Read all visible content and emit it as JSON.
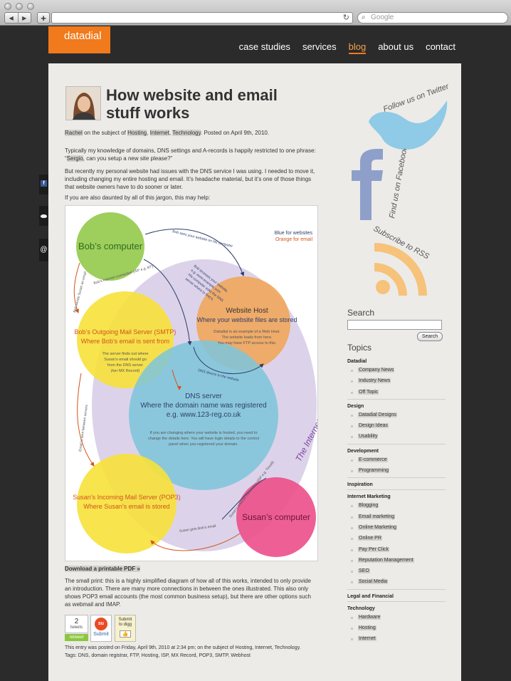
{
  "browser": {
    "search_placeholder": "Google",
    "reload_glyph": "↻",
    "back_glyph": "◀",
    "forward_glyph": "▶",
    "new_tab_glyph": "+"
  },
  "site": {
    "logo": "datadial",
    "nav": [
      {
        "label": "case studies",
        "active": false
      },
      {
        "label": "services",
        "active": false
      },
      {
        "label": "blog",
        "active": true
      },
      {
        "label": "about us",
        "active": false
      },
      {
        "label": "contact",
        "active": false
      }
    ]
  },
  "post": {
    "title": "How website and email stuff works",
    "byline": {
      "author": "Rachel",
      "on_subject": "on the subject of",
      "tags": [
        "Hosting",
        "Internet",
        "Technology"
      ],
      "posted": ". Posted on April 9th, 2010."
    },
    "p1a": "Typically my knowledge of domains, DNS settings and A-records is happily restricted to one phrase: “",
    "p1b": "Sergio",
    "p1c": ", can you setup a new site please?”",
    "p2": "But recently my personal website had issues with the DNS service I was using. I needed to move it, including changing my entire hosting and email. It’s headache material, but it’s one of those things that website owners have to do sooner or later.",
    "p3": "If you are also daunted by all of this jargon, this may help:",
    "download": "Download a printable PDF »",
    "p4": "The small print: this is a highly simplified diagram of how all of this works, intended to only provide an introduction. There are many more connections in between the ones illustrated. This also only shows POP3 email accounts (the most common business setup), but there are other options such as webmail and IMAP.",
    "share": {
      "tweet_count": "2",
      "tweets_label": "tweets",
      "retweet": "retweet",
      "submit": "Submit",
      "digg_a": "Submit",
      "digg_b": "to digg",
      "digg_thumb": "👍"
    },
    "footer1": "This entry was posted on Friday, April 9th, 2010 at 2:34 pm; on the subject of Hosting, Internet, Technology.",
    "footer2_label": "Tags:",
    "footer2_tags": "DNS, domain registrar, FTP, Hosting, ISP, MX Record, POP3, SMTP, Webhost"
  },
  "diagram": {
    "legend_blue": "Blue for websites",
    "legend_orange": "Orange for email",
    "bobs_computer": "Bob’s computer",
    "web_host_title": "Website Host",
    "web_host_sub": "Where your website files are stored",
    "web_host_note1": "Datadial is an example of a Web Host.",
    "web_host_note2": "The website loads from here.",
    "web_host_note3": "You may have FTP access to this.",
    "smtp_title": "Bob’s Outgoing Mail Server (SMTP)",
    "smtp_sub": "Where Bob’s email is sent from",
    "smtp_note1": "The server finds out where",
    "smtp_note2": "Susan’s email should go",
    "smtp_note3": "from the DNS server",
    "smtp_note4": "(her MX Record)",
    "dns_title": "DNS server",
    "dns_sub": "Where the domain name was registered",
    "dns_eg": "e.g. www.123-reg.co.uk",
    "dns_note1": "If you are changing where your website is hosted, you need to",
    "dns_note2": "change the details here. You will have login details to the control",
    "dns_note3": "panel when you registered your domain.",
    "pop3_title": "Susan’s Incoming Mail Server (POP3)",
    "pop3_sub": "Where Susan’s email is stored",
    "susans_computer": "Susan’s computer",
    "internet": "The Internet",
    "arrow_sees": "Bob sees your website on his computer",
    "arrow_conn": "Bob’s Internet connection (ISP e.g. BT)",
    "arrow_browses": "Bob browses your website,",
    "arrow_browses2": "e.g. www.example.com",
    "arrow_browses3": "His computer asks the DNS",
    "arrow_browses4": "server where to find it.",
    "arrow_dns_directs": "DNS directs to the website",
    "arrow_bob_sends": "Bob sends Susan an email",
    "arrow_between": "Email is sent between servers",
    "arrow_susan_conn": "Susan’s Internet connection (ISP e.g. Tiscali)",
    "arrow_susan_gets": "Susan gets Bob’s email"
  },
  "sidebar": {
    "twitter_text": "Follow us on Twitter",
    "facebook_text": "Find us on Facebook",
    "rss_text": "Subscribe to RSS",
    "search_heading": "Search",
    "search_button": "Search",
    "topics_heading": "Topics",
    "categories": [
      {
        "title": "Datadial",
        "items": [
          "Company News",
          "Industry News",
          "Off Topic"
        ]
      },
      {
        "title": "Design",
        "items": [
          "Datadial Designs",
          "Design Ideas",
          "Usability"
        ]
      },
      {
        "title": "Development",
        "items": [
          "E-commerce",
          "Programming"
        ]
      },
      {
        "title": "Inspiration",
        "items": []
      },
      {
        "title": "Internet Marketing",
        "items": [
          "Blogging",
          "Email marketing",
          "Online Marketing",
          "Online PR",
          "Pay Per Click",
          "Reputation Management",
          "SEO",
          "Social Media"
        ]
      },
      {
        "title": "Legal and Financial",
        "items": []
      },
      {
        "title": "Technology",
        "items": [
          "Hardware",
          "Hosting",
          "Internet"
        ]
      }
    ]
  },
  "float_share": {
    "facebook_glyph": "f",
    "email_glyph": "@"
  },
  "colors": {
    "brand_orange": "#f07a1c",
    "page_bg": "#ecebe8",
    "dark_bg": "#2b2b2b",
    "bob_green": "#8dc63f",
    "host_orange": "#f0a65b",
    "smtp_yellow": "#f7e13a",
    "dns_blue": "#7fc5d9",
    "susan_pink": "#ec4f8a",
    "internet_lilac": "#d9d0e8"
  }
}
